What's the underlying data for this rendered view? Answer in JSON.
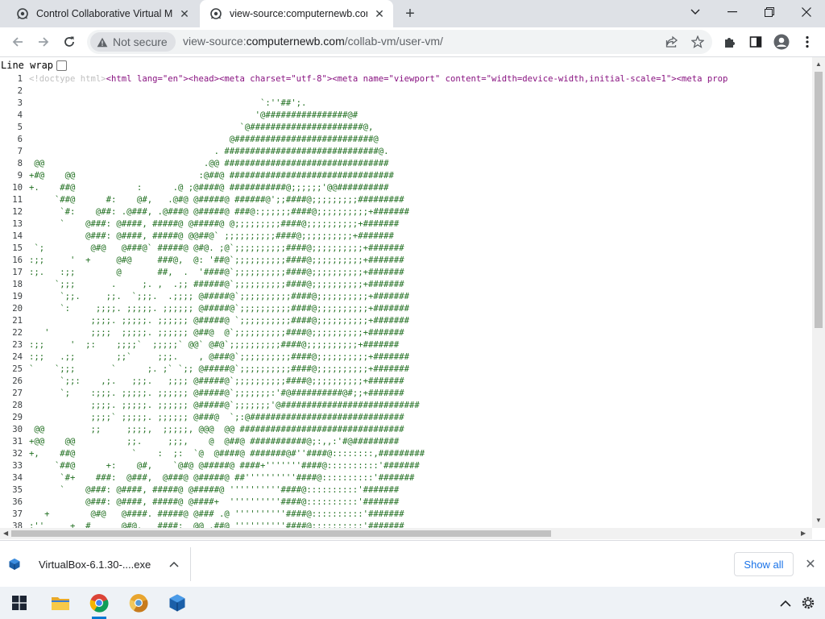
{
  "browser": {
    "tabs": [
      {
        "title": "Control Collaborative Virtual Ma",
        "active": false
      },
      {
        "title": "view-source:computernewb.com",
        "active": true
      }
    ],
    "security_label": "Not secure",
    "url_scheme": "view-source:",
    "url_host": "computernewb.com",
    "url_path": "/collab-vm/user-vm/"
  },
  "page": {
    "line_wrap_label": "Line wrap",
    "line_wrap_checked": false,
    "first_line": {
      "doctype": "<!doctype html>",
      "tags": "<html lang=\"en\"><head><meta charset=\"utf-8\"><meta name=\"viewport\" content=\"width=device-width,initial-scale=1\"><meta prop"
    },
    "lines": [
      "",
      "                                             `:''##';.",
      "                                            '@################@#",
      "                                         `@######################@,",
      "                                       @###########################@",
      "                                    . ##############################@.",
      " @@                               .@@ ################################",
      "+#@    @@                        :@##@ ################################",
      "+.    ##@            :      .@ ;@####@ ###########@;;;;;;'@@##########",
      "     `##@      #:    @#,   .@#@ @#####@ ######@';;####@;;;;;;;;;#########",
      "      `#:    @##: .@###, .@###@ @#####@ ###@:;;;;;;####@;;;;;;;;;;+#######",
      "      `    @###: @####, #####@ @#####@ @;;;;;;;;;####@;;;;;;;;;;+#######",
      "           @###: @####, #####@ @@##@` ;;;;;;;;;;####@;;;;;;;;;;+#######",
      " `;         @#@   @###@` #####@ @#@. ;@`;;;;;;;;;;####@;;;;;;;;;;+#######",
      ":;;     '  +     @#@     ###@,  @: '##@`;;;;;;;;;;####@;;;;;;;;;;+#######",
      ":;.   :;;        @       ##,  .  '####@`;;;;;;;;;;####@;;;;;;;;;;+#######",
      "     `;;;       .     ;. ,  .;; ######@`;;;;;;;;;;####@;;;;;;;;;;+#######",
      "      `;;.     ;;.  `;;;.  .;;;; @#####@`;;;;;;;;;;####@;;;;;;;;;;+#######",
      "      `:     ;;;;. ;;;;;. ;;;;;; @#####@`;;;;;;;;;;####@;;;;;;;;;;+#######",
      "            ;;;;. ;;;;;. ;;;;;; @#####@ `;;;;;;;;;;####@;;;;;;;;;;+#######",
      "   '        ;;;;  ;;;;;. ;;;;;; @##@  @`;;;;;;;;;;####@;;;;;;;;;;+#######",
      ":;;     '  ;:    ;;;;`  ;;;;;` @@` @#@`;;;;;;;;;;####@;;;;;;;;;;+#######",
      ":;;   .;;        ;;`     ;;;.    , @###@`;;;;;;;;;;####@;;;;;;;;;;+#######",
      "`    `;;;       `      ;. ;` `;; @#####@`;;;;;;;;;;####@;;;;;;;;;;+#######",
      "      `;;:    ,;.   ;;;.   ;;;; @#####@`;;;;;;;;;;####@;;;;;;;;;;+#######",
      "      `;    :;;;. ;;;;;. ;;;;;; @#####@`;;;;;;;:'#@##########@#;;+#######",
      "            ;;;;. ;;;;;. ;;;;;; @#####@`;;;;;;;'@###########################",
      "            ;;;;` ;;;;;. ;;;;;; @###@  `;:@##############################",
      " @@         ;;     ;;;;,  ;;;;;, @@@  @@ ################################",
      "+@@    @@          ;;.     ;;;,    @  @##@ ###########@;:,,:'#@#########",
      "+,    ##@           `    :  ;:  `@  @####@ #######@#''####@::::::::,#########",
      "     `##@      +:    @#,    `@#@ @#####@ ####+'''''''####@::::::::::'#######",
      "      `#+    ###:  @###,  @###@ @#####@ ##''''''''''####@::::::::::'#######",
      "      `    @###: @####, #####@ @#####@ ''''''''''####@::::::::::'#######",
      "           @###: @####, #####@ @####+  ''''''''''####@::::::::::'#######",
      "   +        @#@   @####. #####@ @### .@ ''''''''''####@::::::::::'#######",
      ";''     +  #      @#@.   ####:  @@ .##@ ''''''''''####@::::::::::'#######"
    ]
  },
  "downloads": {
    "item_name": "VirtualBox-6.1.30-....exe",
    "show_all_label": "Show all"
  },
  "colors": {
    "source_text": "#1f6e1f",
    "tag": "#881280",
    "attribute": "#994500",
    "value": "#1a1aa6",
    "link": "#1a73e8"
  },
  "taskbar": {
    "apps": [
      "start-icon",
      "file-explorer-icon",
      "chrome-icon",
      "chrome-canary-icon",
      "virtualbox-icon"
    ]
  }
}
